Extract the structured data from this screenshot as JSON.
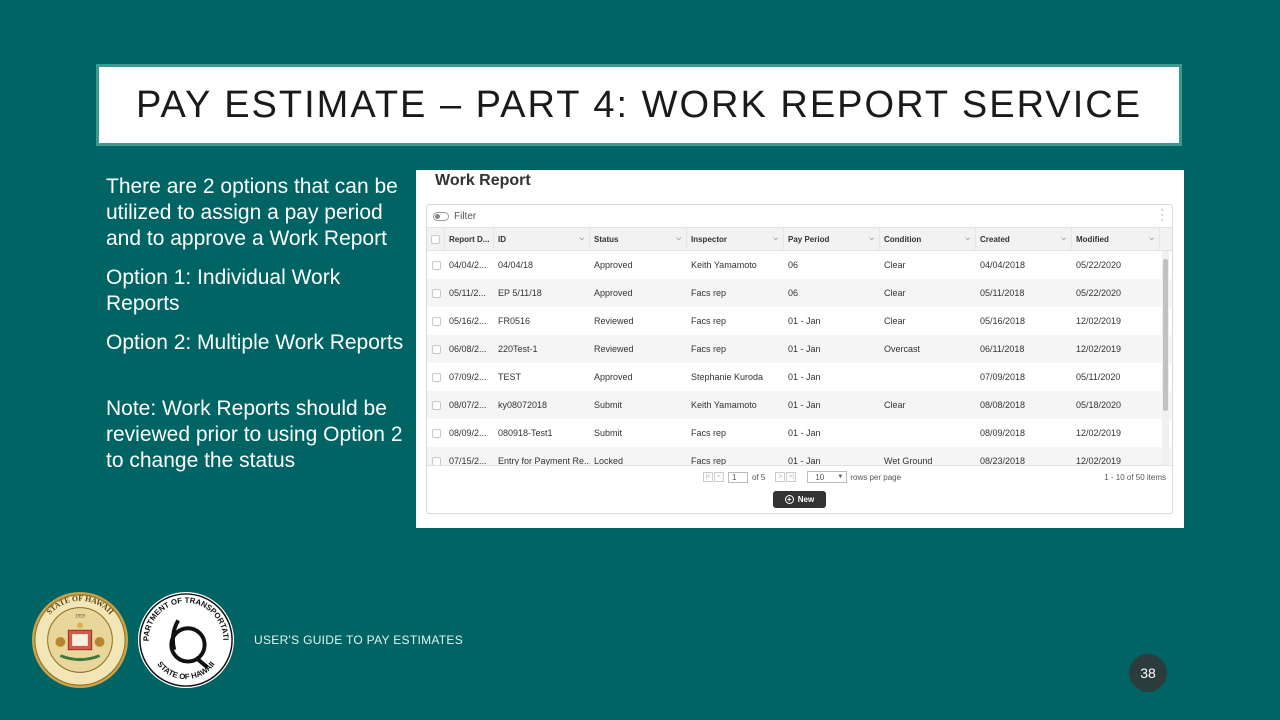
{
  "slide": {
    "title": "PAY ESTIMATE – PART 4: WORK REPORT SERVICE",
    "body_paragraphs": [
      "There are 2 options that can be utilized to assign a pay period and to approve a Work Report",
      "Option 1: Individual Work Reports",
      "Option 2: Multiple Work Reports"
    ],
    "note": "Note:  Work Reports should be reviewed prior to using Option 2 to change the status",
    "footer_text": "USER'S GUIDE TO PAY ESTIMATES",
    "page_number": "38"
  },
  "seals": {
    "state_seal_text": "STATE OF HAWAII",
    "state_seal_year": "1959",
    "dot_seal_top": "DEPARTMENT OF TRANSPORTATION",
    "dot_seal_bottom": "STATE OF HAWAII"
  },
  "work_report": {
    "title": "Work Report",
    "filter_label": "Filter",
    "columns": [
      "Report D...",
      "ID",
      "Status",
      "Inspector",
      "Pay Period",
      "Condition",
      "Created",
      "Modified"
    ],
    "rows": [
      [
        "04/04/2...",
        "04/04/18",
        "Approved",
        "Keith Yamamoto",
        "06",
        "Clear",
        "04/04/2018",
        "05/22/2020"
      ],
      [
        "05/11/2...",
        "EP 5/11/18",
        "Approved",
        "Facs rep",
        "06",
        "Clear",
        "05/11/2018",
        "05/22/2020"
      ],
      [
        "05/16/2...",
        "FR0516",
        "Reviewed",
        "Facs rep",
        "01 - Jan",
        "Clear",
        "05/16/2018",
        "12/02/2019"
      ],
      [
        "06/08/2...",
        "220Test-1",
        "Reviewed",
        "Facs rep",
        "01 - Jan",
        "Overcast",
        "06/11/2018",
        "12/02/2019"
      ],
      [
        "07/09/2...",
        "TEST",
        "Approved",
        "Stephanie Kuroda",
        "01 - Jan",
        "",
        "07/09/2018",
        "05/11/2020"
      ],
      [
        "08/07/2...",
        "ky08072018",
        "Submit",
        "Keith Yamamoto",
        "01 - Jan",
        "Clear",
        "08/08/2018",
        "05/18/2020"
      ],
      [
        "08/09/2...",
        "080918-Test1",
        "Submit",
        "Facs rep",
        "01 - Jan",
        "",
        "08/09/2018",
        "12/02/2019"
      ],
      [
        "07/15/2...",
        "Entry for Payment Re...",
        "Locked",
        "Facs rep",
        "01 - Jan",
        "Wet Ground",
        "08/23/2018",
        "12/02/2019"
      ]
    ],
    "pager": {
      "current_page": "1",
      "of_pages": "of 5",
      "rows_per_page": "10",
      "rows_per_page_label": "rows per page",
      "count_label": "1 - 10 of 50 items"
    },
    "new_button_label": "New"
  },
  "colors": {
    "background": "#006464",
    "title_border": "#3a9a8f",
    "page_badge": "#2c3b3b"
  }
}
